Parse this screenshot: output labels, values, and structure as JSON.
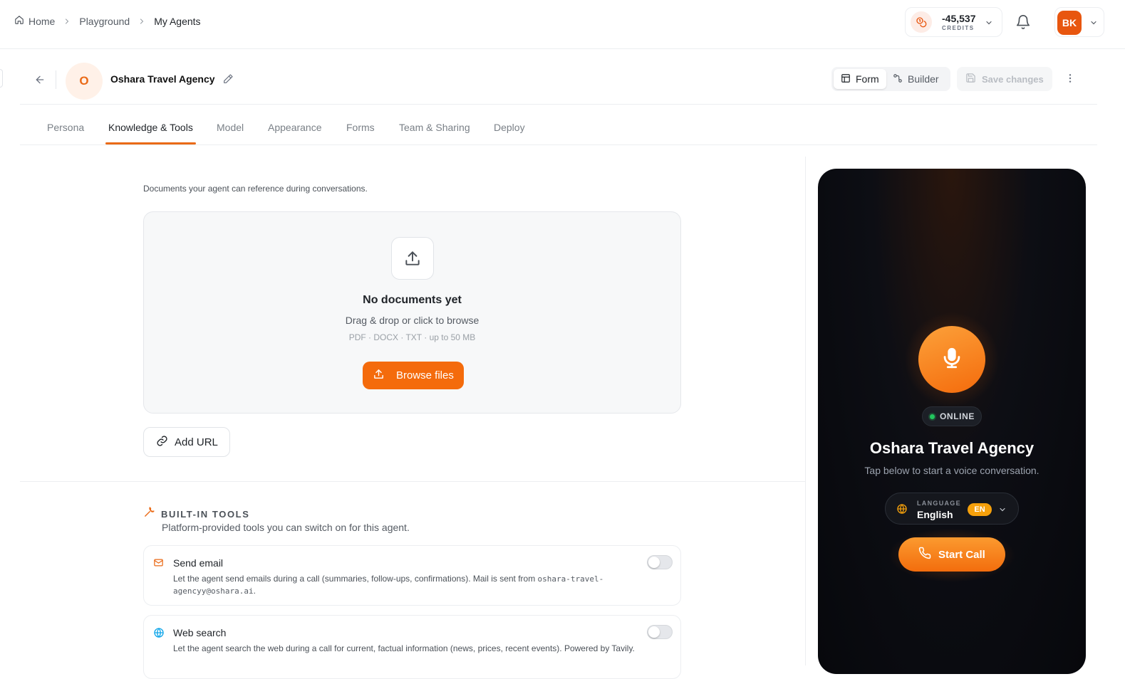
{
  "breadcrumb": {
    "home": "Home",
    "playground": "Playground",
    "current": "My Agents"
  },
  "credits": {
    "value": "-45,537",
    "label": "CREDITS"
  },
  "user": {
    "initials": "BK"
  },
  "agent": {
    "initial": "O",
    "name": "Oshara Travel Agency"
  },
  "mode": {
    "form": "Form",
    "builder": "Builder"
  },
  "save_label": "Save changes",
  "tabs": [
    {
      "label": "Persona"
    },
    {
      "label": "Knowledge & Tools"
    },
    {
      "label": "Model"
    },
    {
      "label": "Appearance"
    },
    {
      "label": "Forms"
    },
    {
      "label": "Team & Sharing"
    },
    {
      "label": "Deploy"
    }
  ],
  "knowledge": {
    "description": "Documents your agent can reference during conversations.",
    "empty_title": "No documents yet",
    "empty_sub": "Drag & drop or click to browse",
    "formats": "PDF · DOCX · TXT · up to 50 MB",
    "browse": "Browse files",
    "add_url": "Add URL"
  },
  "tools": {
    "title": "BUILT-IN TOOLS",
    "subtitle": "Platform-provided tools you can switch on for this agent.",
    "items": [
      {
        "name": "Send email",
        "desc": "Let the agent send emails during a call (summaries, follow-ups, confirmations). Mail is sent from ",
        "address": "oshara-travel-agencyy@oshara.ai",
        "desc_end": ".",
        "enabled": false
      },
      {
        "name": "Web search",
        "desc": "Let the agent search the web during a call for current, factual information (news, prices, recent events). Powered by Tavily.",
        "enabled": false
      }
    ]
  },
  "preview": {
    "status": "ONLINE",
    "name": "Oshara Travel Agency",
    "subtitle": "Tap below to start a voice conversation.",
    "language_label": "LANGUAGE",
    "language_value": "English",
    "language_code": "EN",
    "call_label": "Start Call"
  },
  "colors": {
    "accent": "#f46b0c",
    "online": "#22c55e",
    "badge": "#f5a00b"
  }
}
